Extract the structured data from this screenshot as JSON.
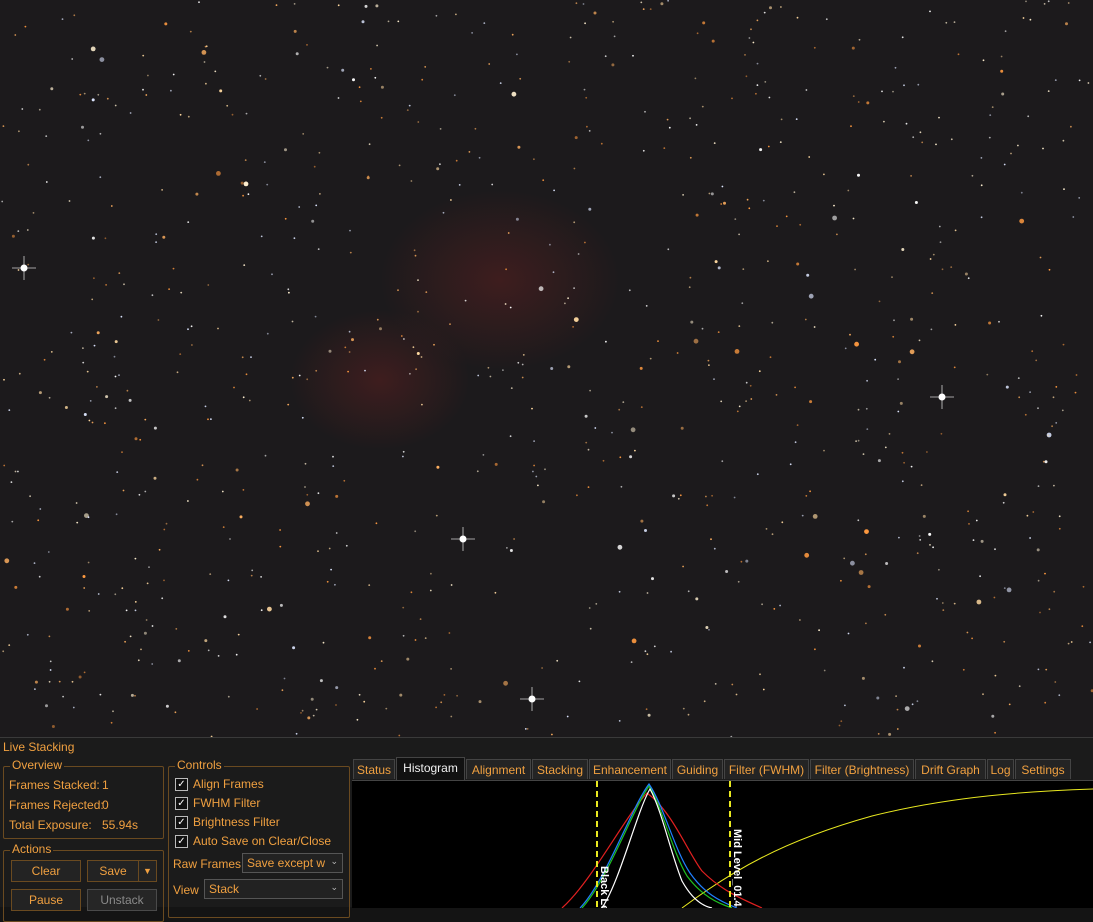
{
  "panel": {
    "title": "Live Stacking"
  },
  "overview": {
    "legend": "Overview",
    "frames_stacked_label": "Frames Stacked:",
    "frames_stacked_value": "1",
    "frames_rejected_label": "Frames Rejected:",
    "frames_rejected_value": "0",
    "total_exposure_label": "Total Exposure:",
    "total_exposure_value": "55.94s"
  },
  "actions": {
    "legend": "Actions",
    "clear": "Clear",
    "save": "Save",
    "save_dropdown_icon": "chevron-down-icon",
    "pause": "Pause",
    "unstack": "Unstack"
  },
  "controls": {
    "legend": "Controls",
    "align_frames": {
      "label": "Align Frames",
      "checked": true
    },
    "fwhm_filter": {
      "label": "FWHM Filter",
      "checked": true
    },
    "brightness_filter": {
      "label": "Brightness Filter",
      "checked": true
    },
    "auto_save": {
      "label": "Auto Save on Clear/Close",
      "checked": true
    },
    "raw_frames_label": "Raw Frames",
    "raw_frames_value": "Save except w",
    "view_label": "View",
    "view_value": "Stack"
  },
  "tabs": [
    "Status",
    "Histogram",
    "Alignment",
    "Stacking",
    "Enhancement",
    "Guiding",
    "Filter (FWHM)",
    "Filter (Brightness)",
    "Drift Graph",
    "Log",
    "Settings"
  ],
  "active_tab": "Histogram",
  "histogram": {
    "black_level_label": "Black Le",
    "mid_level_label": "Mid Level_01.4",
    "colors": {
      "red": "#e02020",
      "green": "#20c020",
      "blue": "#2080ff",
      "white": "#ffffff",
      "curve": "#e8e820",
      "marker": "#e8e820"
    }
  },
  "colors": {
    "accent": "#f0a040",
    "background": "#1b1b1b"
  }
}
